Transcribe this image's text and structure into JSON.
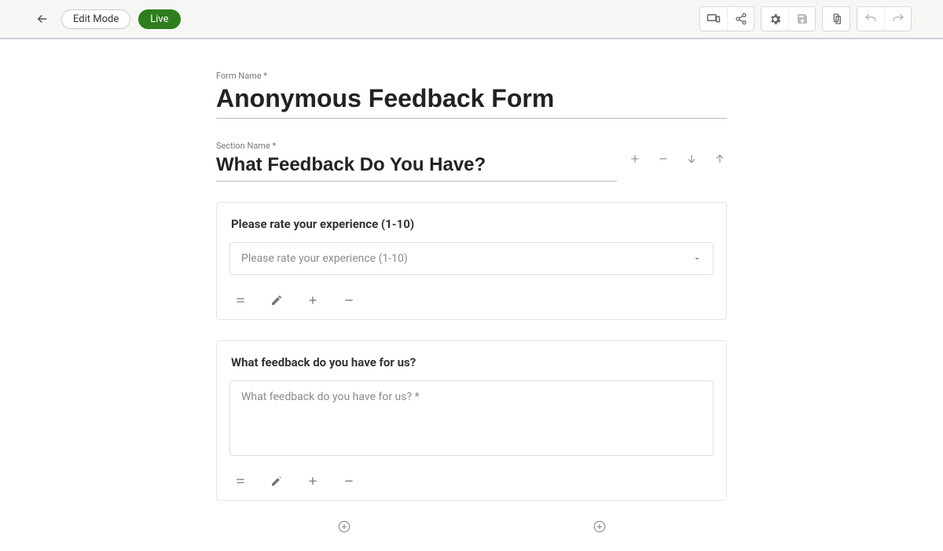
{
  "topbar": {
    "edit_mode_label": "Edit Mode",
    "live_label": "Live"
  },
  "form": {
    "name_label": "Form Name *",
    "name_value": "Anonymous Feedback Form"
  },
  "section": {
    "name_label": "Section Name *",
    "name_value": "What Feedback Do You Have?"
  },
  "questions": [
    {
      "title": "Please rate your experience (1-10)",
      "placeholder": "Please rate your experience (1-10)",
      "type": "select"
    },
    {
      "title": "What feedback do you have for us?",
      "placeholder": "What feedback do you have for us? *",
      "type": "textarea"
    }
  ]
}
